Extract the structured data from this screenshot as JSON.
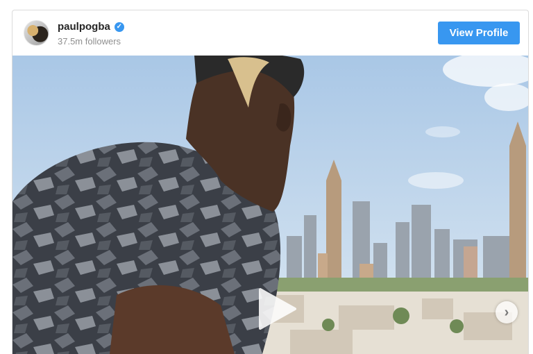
{
  "profile": {
    "username": "paulpogba",
    "followers": "37.5m followers",
    "verified_icon": "verified-badge-icon",
    "view_profile_label": "View Profile"
  },
  "media": {
    "play_icon": "play-icon",
    "next_icon": "chevron-right-icon"
  },
  "colors": {
    "accent": "#3897f0",
    "username": "#262626",
    "muted": "#8e8e8e",
    "border": "#dbdbdb"
  }
}
